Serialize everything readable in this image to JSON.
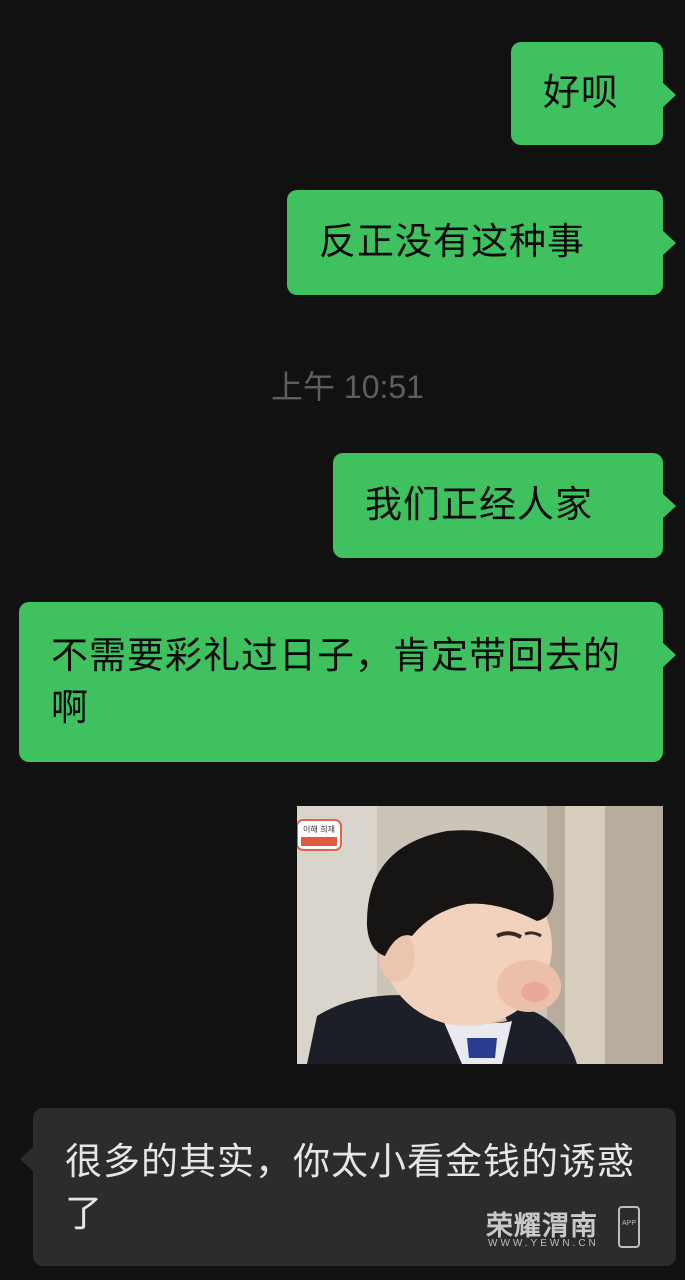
{
  "chat": {
    "messages": [
      {
        "side": "out",
        "text": "好呗"
      },
      {
        "side": "out",
        "text": "反正没有这种事"
      },
      {
        "side": "out",
        "text": "我们正经人家"
      },
      {
        "side": "out",
        "text": "不需要彩礼过日子，肯定带回去的啊"
      },
      {
        "side": "out",
        "type": "image",
        "content": "child-puffed-cheeks-photo",
        "overlay_caption": "이해 희재"
      },
      {
        "side": "in",
        "text": "很多的其实，你太小看金钱的诱惑了"
      }
    ],
    "timestamp": "上午 10:51"
  },
  "watermark": {
    "title": "荣耀渭南",
    "url": "WWW.YEWN.CN",
    "badge": "APP"
  },
  "colors": {
    "background": "#111111",
    "outgoing_bubble": "#3fc160",
    "incoming_bubble": "#2c2c2c",
    "timestamp_text": "#5e5e5e"
  }
}
